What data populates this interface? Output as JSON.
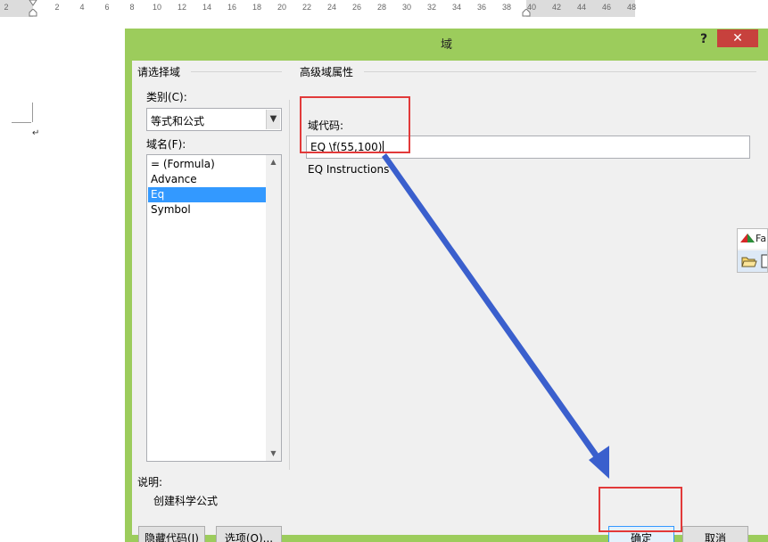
{
  "ruler": {
    "ticks": [
      "2",
      "2",
      "4",
      "6",
      "8",
      "10",
      "12",
      "14",
      "16",
      "18",
      "20",
      "22",
      "24",
      "26",
      "28",
      "30",
      "32",
      "34",
      "36",
      "38",
      "40",
      "42",
      "44",
      "46",
      "48"
    ]
  },
  "dialog": {
    "title": "域",
    "help_label": "?",
    "close_label": "✕",
    "left_group_title": "请选择域",
    "category_label": "类别(C):",
    "category_value": "等式和公式",
    "field_names_label": "域名(F):",
    "field_names": [
      "= (Formula)",
      "Advance",
      "Eq",
      "Symbol"
    ],
    "selected_field": "Eq",
    "right_group_title": "高级域属性",
    "field_code_label": "域代码:",
    "field_code_value": "EQ \\f(55,100)",
    "field_code_hint": "EQ Instructions",
    "description_label": "说明:",
    "description_text": "创建科学公式",
    "hide_codes_button": "隐藏代码(I)",
    "options_button": "选项(O)...",
    "ok_button": "确定",
    "cancel_button": "取消"
  },
  "side_toolbar": {
    "label": "Fa"
  },
  "colors": {
    "dialog_frame": "#9ccc5c",
    "close_button": "#c7413d",
    "selection": "#3399ff",
    "highlight_box": "#e23a3a",
    "arrow": "#3a5fcd"
  }
}
